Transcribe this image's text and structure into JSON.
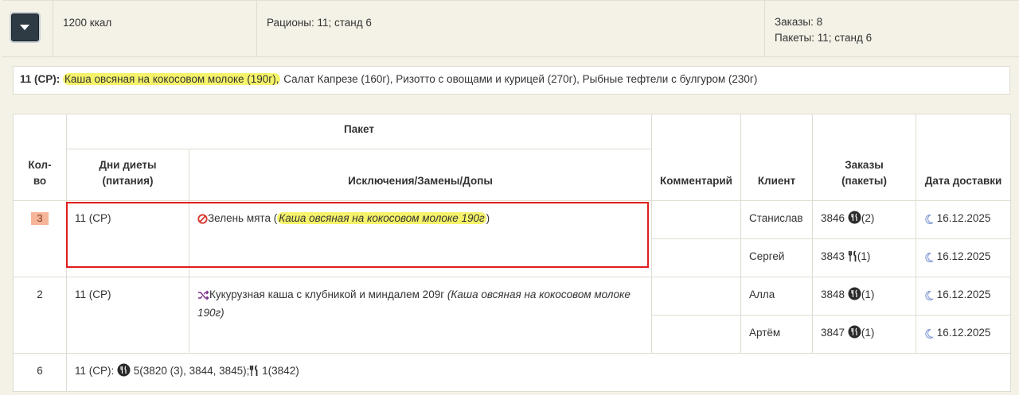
{
  "summary": {
    "kcal": "1200 ккал",
    "rations": "Рационы: 11; станд 6",
    "orders_line1": "Заказы: 8",
    "orders_line2": "Пакеты: 11; станд 6"
  },
  "menu": {
    "label": "11 (СР):",
    "highlighted_item": "Каша овсяная на кокосовом молоке (190г),",
    "rest": " Салат Капрезе (160г), Ризотто с овощами и курицей (270г), Рыбные тефтели с булгуром (230г)"
  },
  "table": {
    "headers": {
      "qty_line1": "Кол-",
      "qty_line2": "во",
      "package": "Пакет",
      "diet_days_line1": "Дни диеты",
      "diet_days_line2": "(питания)",
      "exclusions": "Исключения/Замены/Допы",
      "comment": "Комментарий",
      "client": "Клиент",
      "orders_line1": "Заказы",
      "orders_line2": "(пакеты)",
      "delivery_date": "Дата доставки"
    },
    "group1": {
      "qty": "3",
      "diet": "11 (СР)",
      "exclusion_text": "Зелень мята",
      "exclusion_open": " (",
      "exclusion_dish": "Каша овсяная на кокосовом молоке 190г",
      "exclusion_close": ")",
      "rows": [
        {
          "client": "Станислав",
          "order": "3846",
          "count": "(2)",
          "date": "16.12.2025"
        },
        {
          "client": "Сергей",
          "order": "3843",
          "count": "(1)",
          "date": "16.12.2025"
        }
      ]
    },
    "group2": {
      "qty": "2",
      "diet": "11 (СР)",
      "replacement_text": "Кукурузная каша с клубникой и миндалем 209г",
      "replacement_dish": "(Каша овсяная на кокосовом молоке 190г)",
      "rows": [
        {
          "client": "Алла",
          "order": "3848",
          "count": "(1)",
          "date": "16.12.2025"
        },
        {
          "client": "Артём",
          "order": "3847",
          "count": "(1)",
          "date": "16.12.2025"
        }
      ]
    },
    "footer": {
      "qty": "6",
      "diet_label": "11 (СР):",
      "packaged_summary": "5(3820 (3), 3844, 3845);",
      "cutlery_summary": "1(3842)"
    }
  },
  "icons": {
    "exclusion": "prohibited-icon",
    "replacement": "shuffle-icon",
    "packaged": "meal-package-icon",
    "cutlery": "fork-knife-icon",
    "night": "crescent-moon-icon"
  },
  "colors": {
    "highlight": "#f5f36a",
    "qty_badge": "#f4b59a",
    "focus_box": "#e01e1e",
    "exclusion_icon": "#d9342b",
    "replacement_icon": "#7b2a8a",
    "moon_icon": "#8a9fd6"
  }
}
